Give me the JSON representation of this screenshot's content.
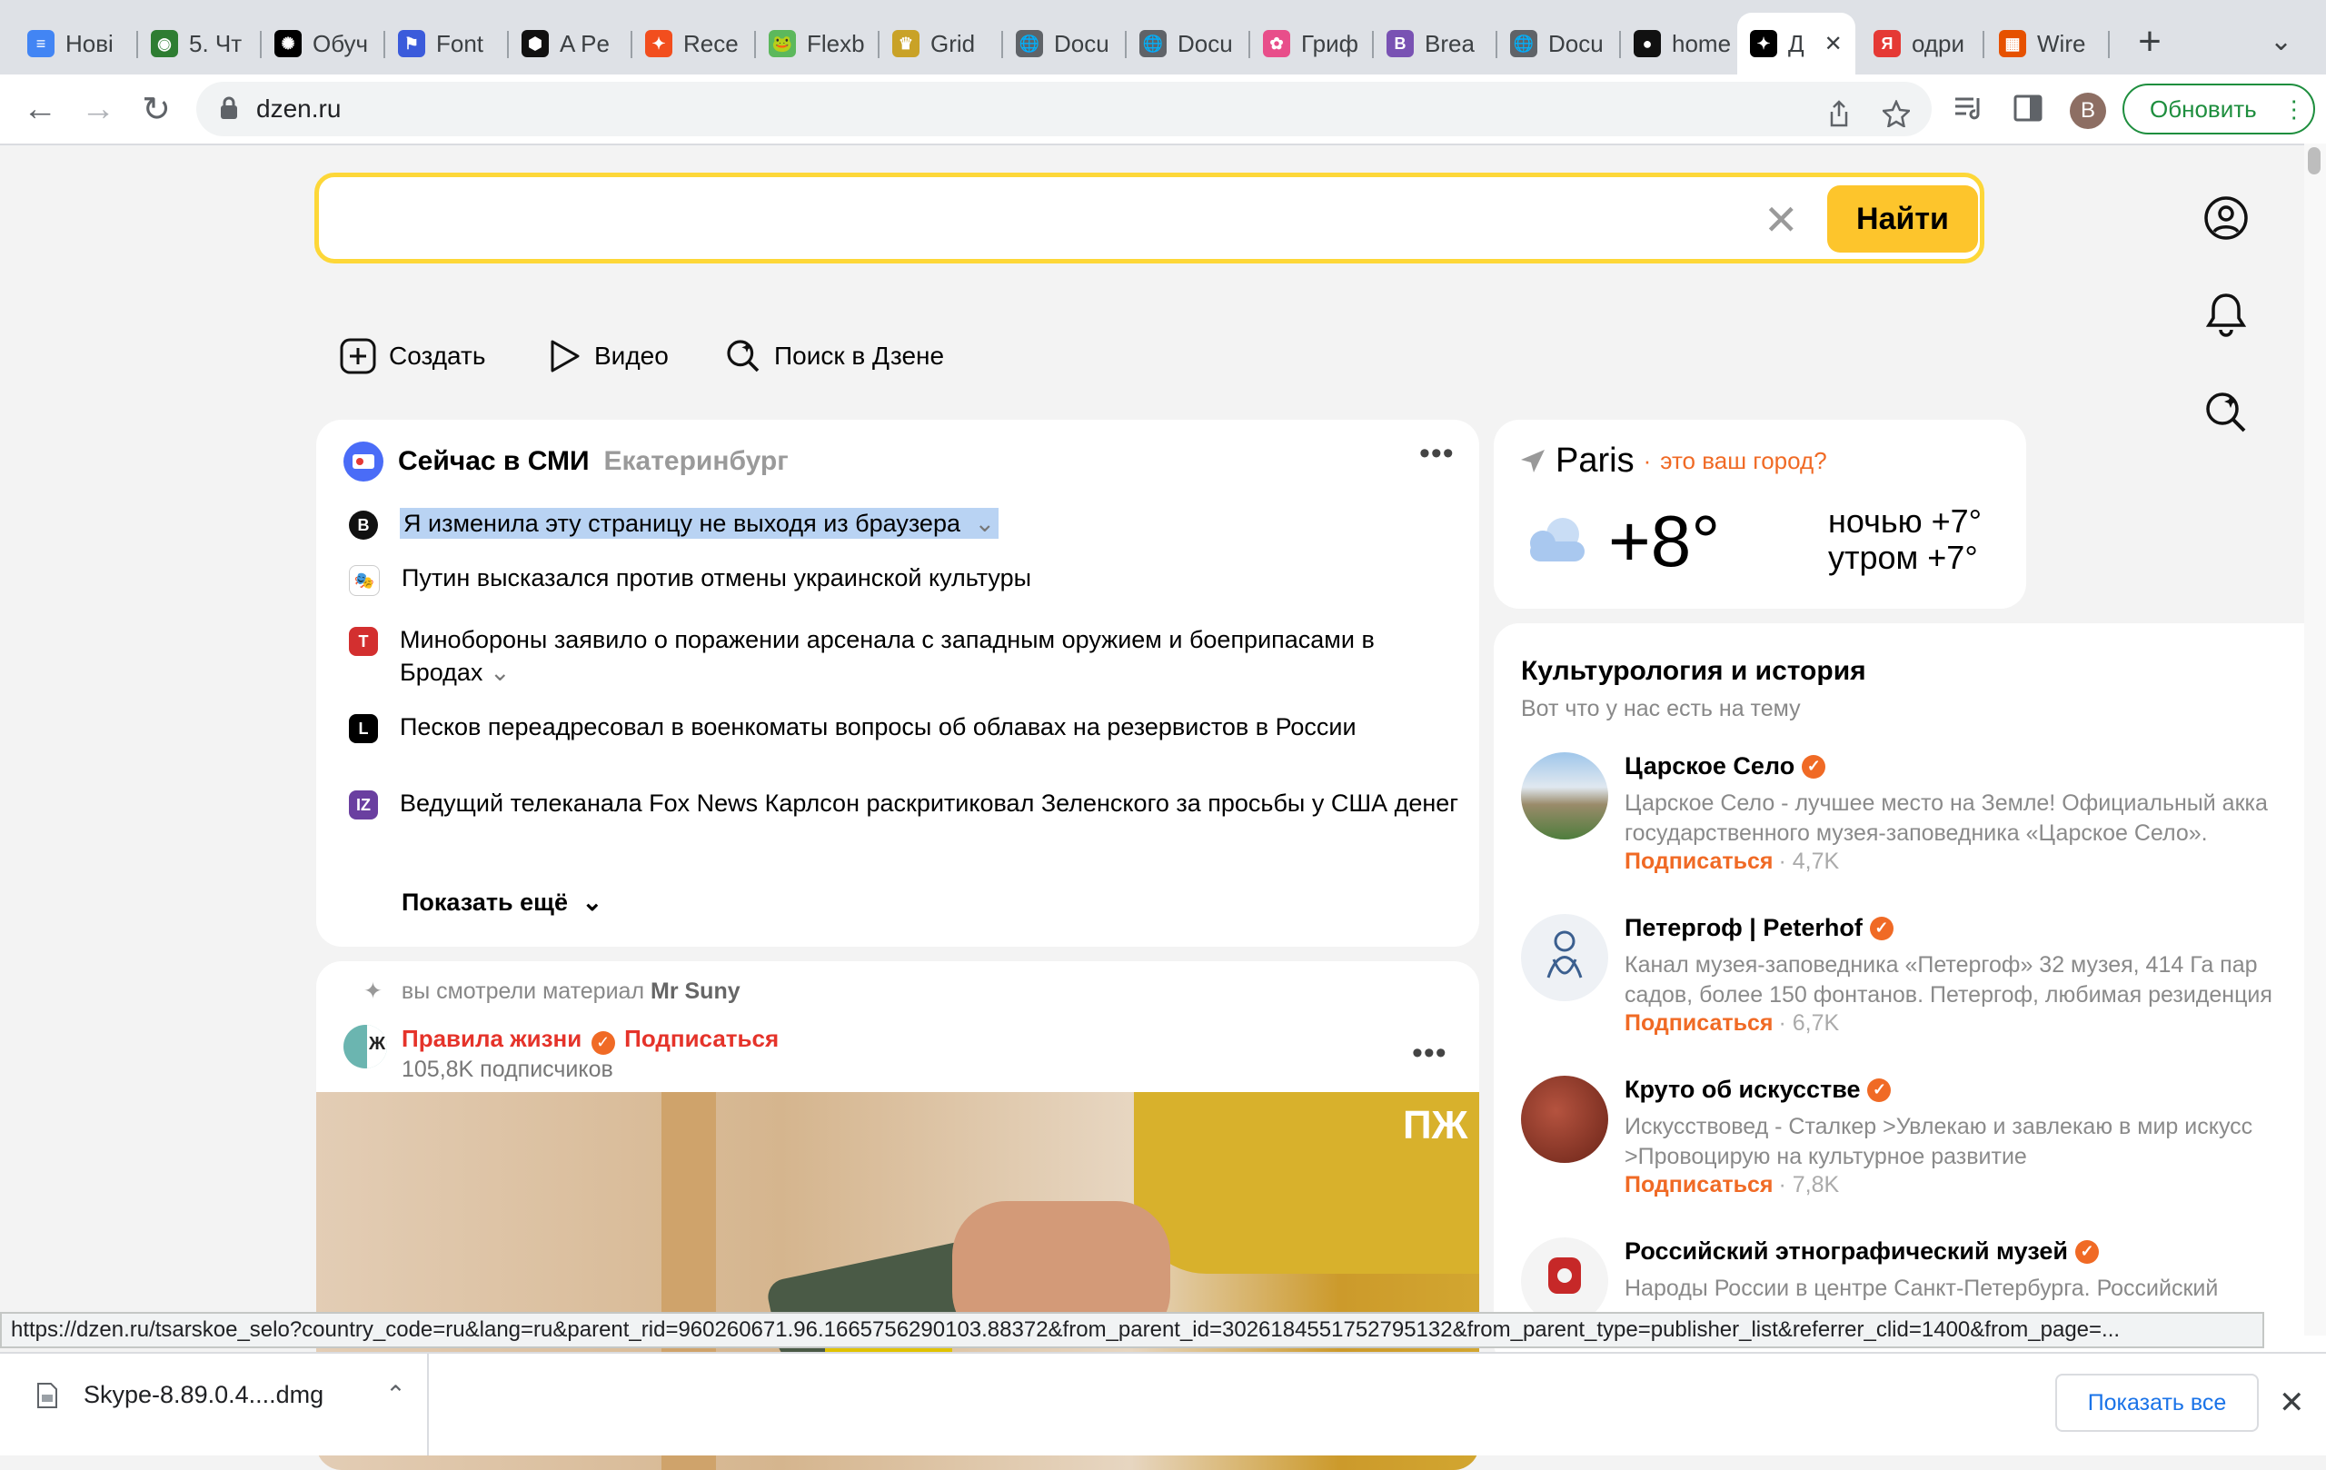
{
  "browser": {
    "tabs": [
      {
        "title": "Нові",
        "color": "#4285f4",
        "glyph": "≡"
      },
      {
        "title": "5. Чт",
        "color": "#2e7d32",
        "glyph": "◉"
      },
      {
        "title": "Обуч",
        "color": "#000000",
        "glyph": "✺"
      },
      {
        "title": "Font",
        "color": "#3b5bdb",
        "glyph": "⚑"
      },
      {
        "title": "A Pe",
        "color": "#111111",
        "glyph": "⬢"
      },
      {
        "title": "Rece",
        "color": "#f24e1e",
        "glyph": "✦"
      },
      {
        "title": "Flexb",
        "color": "#5cb85c",
        "glyph": "🐸"
      },
      {
        "title": "Grid",
        "color": "#c9a227",
        "glyph": "♛"
      },
      {
        "title": "Docu",
        "color": "#5f6368",
        "glyph": "🌐"
      },
      {
        "title": "Docu",
        "color": "#5f6368",
        "glyph": "🌐"
      },
      {
        "title": "Гриф",
        "color": "#e84e8a",
        "glyph": "✿"
      },
      {
        "title": "Brea",
        "color": "#7952b3",
        "glyph": "B"
      },
      {
        "title": "Docu",
        "color": "#5f6368",
        "glyph": "🌐"
      },
      {
        "title": "home",
        "color": "#111111",
        "glyph": "●"
      },
      {
        "title": "Д",
        "color": "#000000",
        "glyph": "✦",
        "active": true
      },
      {
        "title": "одри",
        "color": "#e53935",
        "glyph": "Я"
      },
      {
        "title": "Wire",
        "color": "#e65100",
        "glyph": "▦"
      }
    ],
    "url": "dzen.ru",
    "profile_letter": "B",
    "update_label": "Обновить"
  },
  "search": {
    "value": "",
    "placeholder": "",
    "button": "Найти"
  },
  "quick_actions": {
    "create": "Создать",
    "video": "Видео",
    "search_dzen": "Поиск в Дзене"
  },
  "news": {
    "title": "Сейчас в СМИ",
    "city": "Екатеринбург",
    "items": [
      {
        "source_glyph": "B",
        "source_color": "#111111",
        "text": "Я изменила эту страницу не выходя из браузера",
        "highlight": true,
        "expand": true
      },
      {
        "source_glyph": "🎭",
        "source_color": "#ffffff",
        "text": "Путин высказался против отмены украинской культуры"
      },
      {
        "source_glyph": "T",
        "source_color": "#d32f2f",
        "text": "Минобороны заявило о поражении арсенала с западным оружием и боеприпасами в Бродах",
        "expand": true
      },
      {
        "source_glyph": "L",
        "source_color": "#000000",
        "text": "Песков переадресовал в военкоматы вопросы об облавах на резервистов в России"
      },
      {
        "source_glyph": "IZ",
        "source_color": "#6a3fa0",
        "text": "Ведущий телеканала Fox News Карлсон раскритиковал Зеленского за просьбы у США денег"
      }
    ],
    "show_more": "Показать ещё"
  },
  "post": {
    "hint_prefix": "вы смотрели материал",
    "hint_author": "Mr Suny",
    "channel": "Правила жизни",
    "subscribe": "Подписаться",
    "subscribers": "105,8K подписчиков",
    "watermark": "ПЖ"
  },
  "weather": {
    "city": "Paris",
    "ask": "это ваш город?",
    "temp": "+8°",
    "night": "ночью +7°",
    "morning": "утром +7°"
  },
  "reco": {
    "title": "Культурология и история",
    "subtitle": "Вот что у нас есть на тему",
    "items": [
      {
        "name": "Царское Село",
        "desc1": "Царское Село - лучшее место на Земле! Официальный акка",
        "desc2": "государственного музея-заповедника «Царское Село».",
        "subscribe": "Подписаться",
        "count": "· 4,7K"
      },
      {
        "name": "Петергоф | Peterhof",
        "desc1": "Канал музея-заповедника «Петергоф» 32 музея, 414 Га пар",
        "desc2": "садов, более 150 фонтанов. Петергоф, любимая резиденция",
        "subscribe": "Подписаться",
        "count": "· 6,7K"
      },
      {
        "name": "Круто об искусстве",
        "desc1": "Искусствовед - Сталкер >Увлекаю и завлекаю в мир искусс",
        "desc2": ">Провоцирую на культурное развитие",
        "subscribe": "Подписаться",
        "count": "· 7,8K"
      },
      {
        "name": "Российский этнографический музей",
        "desc1": "Народы России в центре Санкт-Петербурга. Российский",
        "desc2": "",
        "subscribe": "",
        "count": ""
      }
    ]
  },
  "status_url": "https://dzen.ru/tsarskoe_selo?country_code=ru&lang=ru&parent_rid=960260671.96.1665756290103.88372&from_parent_id=3026184551752795132&from_parent_type=publisher_list&referrer_clid=1400&from_page=...",
  "download": {
    "file": "Skype-8.89.0.4....dmg",
    "show_all": "Показать все"
  },
  "colors": {
    "accent_yellow": "#fdc52c",
    "search_border": "#fdd738",
    "orange": "#f06a25",
    "red_channel": "#e5332a",
    "update_green": "#1e8e3e"
  }
}
